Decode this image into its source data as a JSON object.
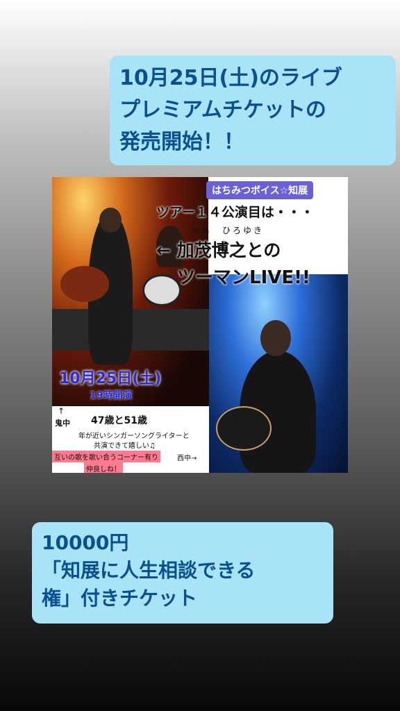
{
  "caption_top": {
    "lines": [
      "10月25日(土)のライブ",
      "プレミアムチケットの",
      "発売開始！！"
    ]
  },
  "flyer": {
    "badge": "はちみつボイス☆知展",
    "tour_line": "ツアー１４公演目は・・・",
    "ruby": "かも　ひろゆき",
    "name_line": "← 加茂博之との",
    "live_line": "ツーマンLIVE!!",
    "date": "10月25日(土)",
    "time": "19時開演",
    "arrow_up": "↑",
    "oninaka": "鬼中",
    "ages": "47歳と51歳",
    "desc_line1": "年が近いシンガーソングライターと",
    "desc_line2": "共演できて嬉しい♫",
    "corner_note": "互いの歌を歌い合うコーナー有り",
    "nishinaka": "西中→",
    "friends": "仲良しね！"
  },
  "caption_bottom": {
    "lines": [
      "10000円",
      "「知展に人生相談できる",
      "権」付きチケット"
    ]
  }
}
